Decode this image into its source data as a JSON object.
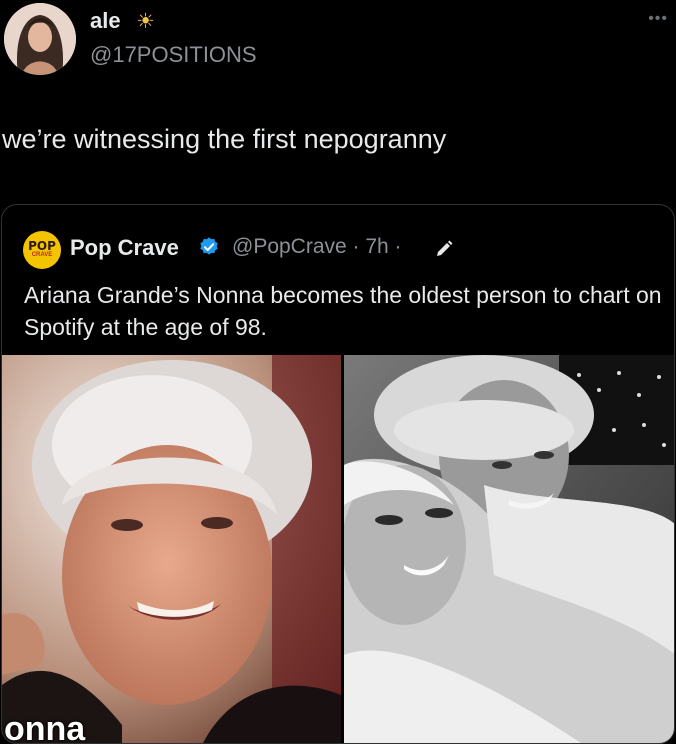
{
  "tweet": {
    "author_name": "ale",
    "author_emoji": "☀",
    "author_handle": "@17POSITIONS",
    "more_icon": "ellipsis-icon",
    "text": "we’re witnessing the first nepogranny"
  },
  "quoted_tweet": {
    "logo_text_top": "POP",
    "logo_text_bottom": "CRAVE",
    "author_name": "Pop Crave",
    "verified_color": "#1d9bf0",
    "handle_time": "@PopCrave · 7h ·",
    "text": "Ariana Grande’s Nonna becomes the oldest person to chart on Spotify at the age of 98.",
    "image_caption": "onna"
  },
  "colors": {
    "background": "#000000",
    "primary_text": "#e7e9ea",
    "secondary_text": "#8b9197",
    "border": "#2f3336"
  }
}
